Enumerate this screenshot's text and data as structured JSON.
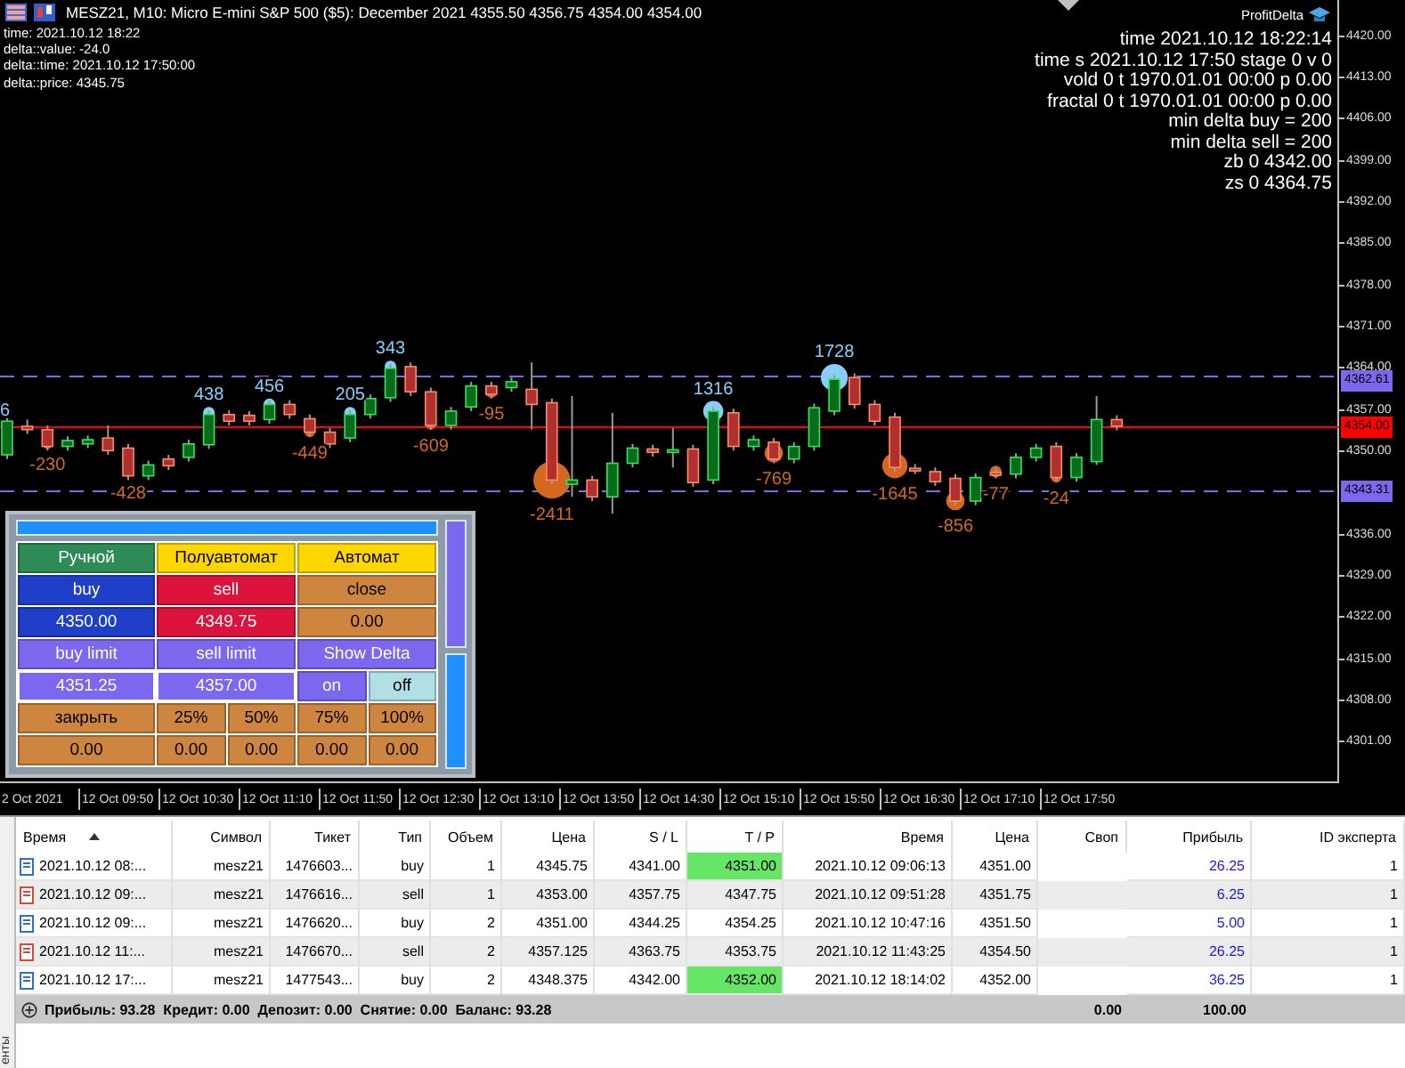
{
  "chart": {
    "title": "MESZ21, M10:  Micro E-mini S&P 500 ($5): December 2021  4355.50 4356.75 4354.00 4354.00",
    "info_left": [
      "time: 2021.10.12 18:22",
      "delta::value: -24.0",
      "delta::time: 2021.10.12 17:50:00",
      "delta::price: 4345.75"
    ],
    "indicator_name": "ProfitDelta",
    "info_right": [
      "time 2021.10.12 18:22:14",
      "time s 2021.10.12 17:50 stage 0 v 0",
      "vold 0 t 1970.01.01 00:00 p 0.00",
      "fractal 0 t 1970.01.01 00:00 p 0.00",
      "min delta buy = 200",
      "min delta sell = 200",
      "zb 0 4342.00",
      "zs 0 4364.75"
    ],
    "delta_markers": [
      {
        "text": "6",
        "kind": "buy"
      },
      {
        "text": "-230",
        "kind": "sell"
      },
      {
        "text": "-428",
        "kind": "sell"
      },
      {
        "text": "438",
        "kind": "buy"
      },
      {
        "text": "456",
        "kind": "buy"
      },
      {
        "text": "-449",
        "kind": "sell"
      },
      {
        "text": "205",
        "kind": "buy"
      },
      {
        "text": "343",
        "kind": "buy"
      },
      {
        "text": "-609",
        "kind": "sell"
      },
      {
        "text": "-95",
        "kind": "sell"
      },
      {
        "text": "-2411",
        "kind": "sell"
      },
      {
        "text": "1316",
        "kind": "buy"
      },
      {
        "text": "-769",
        "kind": "sell"
      },
      {
        "text": "1728",
        "kind": "buy"
      },
      {
        "text": "-1645",
        "kind": "sell"
      },
      {
        "text": "-856",
        "kind": "sell"
      },
      {
        "text": "-77",
        "kind": "sell"
      },
      {
        "text": "-24",
        "kind": "sell"
      }
    ],
    "price_ticks": [
      "4420.00",
      "4413.00",
      "4406.00",
      "4399.00",
      "4392.00",
      "4385.00",
      "4378.00",
      "4371.00",
      "4364.00",
      "4357.00",
      "4350.00",
      "4336.00",
      "4329.00",
      "4322.00",
      "4315.00",
      "4308.00",
      "4301.00"
    ],
    "level_labels": [
      {
        "text": "4362.61",
        "color": "#7b68ee"
      },
      {
        "text": "4354.00",
        "color": "#ff0000"
      },
      {
        "text": "4343.31",
        "color": "#7b68ee"
      }
    ],
    "time_labels": [
      "2 Oct 2021",
      "12 Oct 09:50",
      "12 Oct 10:30",
      "12 Oct 11:10",
      "12 Oct 11:50",
      "12 Oct 12:30",
      "12 Oct 13:10",
      "12 Oct 13:50",
      "12 Oct 14:30",
      "12 Oct 15:10",
      "12 Oct 15:50",
      "12 Oct 16:30",
      "12 Oct 17:10",
      "12 Oct 17:50"
    ]
  },
  "panel": {
    "modes": [
      {
        "label": "Ручной",
        "selected": true
      },
      {
        "label": "Полуавтомат",
        "selected": false
      },
      {
        "label": "Автомат",
        "selected": false
      }
    ],
    "buy": {
      "label": "buy",
      "value": "4350.00"
    },
    "sell": {
      "label": "sell",
      "value": "4349.75"
    },
    "close": {
      "label": "close",
      "value": "0.00"
    },
    "buy_limit": {
      "label": "buy limit",
      "value": "4351.25"
    },
    "sell_limit": {
      "label": "sell limit",
      "value": "4357.00"
    },
    "show_delta": {
      "label": "Show Delta",
      "options": [
        {
          "label": "on",
          "selected": false
        },
        {
          "label": "off",
          "selected": true
        }
      ]
    },
    "close_parts": [
      {
        "label": "закрыть",
        "value": "0.00"
      },
      {
        "label": "25%",
        "value": "0.00"
      },
      {
        "label": "50%",
        "value": "0.00"
      },
      {
        "label": "75%",
        "value": "0.00"
      },
      {
        "label": "100%",
        "value": "0.00"
      }
    ]
  },
  "terminal": {
    "side_tab": "енты",
    "columns": [
      {
        "label": "Время",
        "sorted": true
      },
      {
        "label": "Символ",
        "sorted": false
      },
      {
        "label": "Тикет",
        "sorted": false
      },
      {
        "label": "Тип",
        "sorted": false
      },
      {
        "label": "Объем",
        "sorted": false
      },
      {
        "label": "Цена",
        "sorted": false
      },
      {
        "label": "S / L",
        "sorted": false
      },
      {
        "label": "T / P",
        "sorted": false
      },
      {
        "label": "Время",
        "sorted": false
      },
      {
        "label": "Цена",
        "sorted": false
      },
      {
        "label": "Своп",
        "sorted": false
      },
      {
        "label": "Прибыль",
        "sorted": false
      },
      {
        "label": "ID эксперта",
        "sorted": false
      }
    ],
    "rows": [
      {
        "kind": "buy",
        "open_time": "2021.10.12 08:...",
        "symbol": "mesz21",
        "ticket": "1476603...",
        "type": "buy",
        "volume": "1",
        "price": "4345.75",
        "sl": "4341.00",
        "tp": "4351.00",
        "tp_hit": true,
        "close_time": "2021.10.12 09:06:13",
        "close_price": "4351.00",
        "profit": "26.25",
        "expert_id": "1"
      },
      {
        "kind": "sell",
        "open_time": "2021.10.12 09:...",
        "symbol": "mesz21",
        "ticket": "1476616...",
        "type": "sell",
        "volume": "1",
        "price": "4353.00",
        "sl": "4357.75",
        "tp": "4347.75",
        "tp_hit": false,
        "close_time": "2021.10.12 09:51:28",
        "close_price": "4351.75",
        "profit": "6.25",
        "expert_id": "1"
      },
      {
        "kind": "buy",
        "open_time": "2021.10.12 09:...",
        "symbol": "mesz21",
        "ticket": "1476620...",
        "type": "buy",
        "volume": "2",
        "price": "4351.00",
        "sl": "4344.25",
        "tp": "4354.25",
        "tp_hit": false,
        "close_time": "2021.10.12 10:47:16",
        "close_price": "4351.50",
        "profit": "5.00",
        "expert_id": "1"
      },
      {
        "kind": "sell",
        "open_time": "2021.10.12 11:...",
        "symbol": "mesz21",
        "ticket": "1476670...",
        "type": "sell",
        "volume": "2",
        "price": "4357.125",
        "sl": "4363.75",
        "tp": "4353.75",
        "tp_hit": false,
        "close_time": "2021.10.12 11:43:25",
        "close_price": "4354.50",
        "profit": "26.25",
        "expert_id": "1"
      },
      {
        "kind": "buy",
        "open_time": "2021.10.12 17:...",
        "symbol": "mesz21",
        "ticket": "1477543...",
        "type": "buy",
        "volume": "2",
        "price": "4348.375",
        "sl": "4342.00",
        "tp": "4352.00",
        "tp_hit": true,
        "close_time": "2021.10.12 18:14:02",
        "close_price": "4352.00",
        "profit": "36.25",
        "expert_id": "1"
      }
    ],
    "summary": {
      "text": "Прибыль: 93.28  Кредит: 0.00  Депозит: 0.00  Снятие: 0.00  Баланс: 93.28",
      "swap": "0.00",
      "profit": "100.00"
    }
  }
}
